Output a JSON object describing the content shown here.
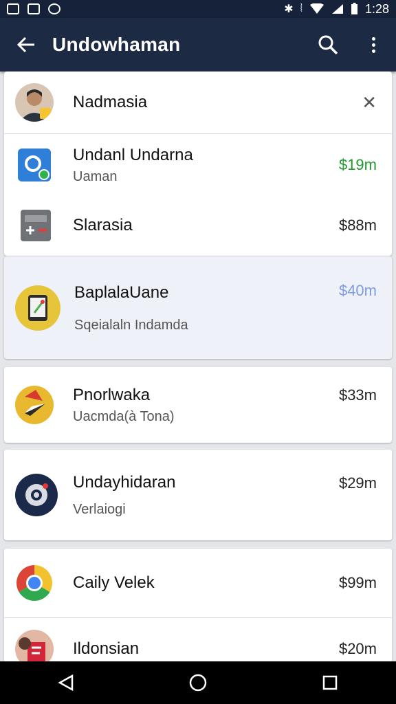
{
  "status": {
    "time": "1:28"
  },
  "app_bar": {
    "title": "Undowhaman"
  },
  "top_item": {
    "name": "Nadmasia"
  },
  "items": [
    {
      "name": "Undanl Undarna",
      "sub": "Uaman",
      "amount": "$19m",
      "amount_color": "#1e9a2c"
    },
    {
      "name": "Slarasia",
      "sub": "",
      "amount": "$88m",
      "amount_color": "#222222"
    },
    {
      "name": "BaplalaUane",
      "sub": "Sqeialaln Indamda",
      "amount": "$40m",
      "amount_color": "#7f9be0"
    },
    {
      "name": "Pnorlwaka",
      "sub": "Uacmda(à Tona)",
      "amount": "$33m",
      "amount_color": "#222222"
    },
    {
      "name": "Undayhidaran",
      "sub": "Verlaiogi",
      "amount": "$29m",
      "amount_color": "#222222"
    },
    {
      "name": "Caily Velek",
      "sub": "",
      "amount": "$99m",
      "amount_color": "#222222"
    },
    {
      "name": "Ildonsian",
      "sub": "",
      "amount": "$20m",
      "amount_color": "#222222"
    }
  ]
}
